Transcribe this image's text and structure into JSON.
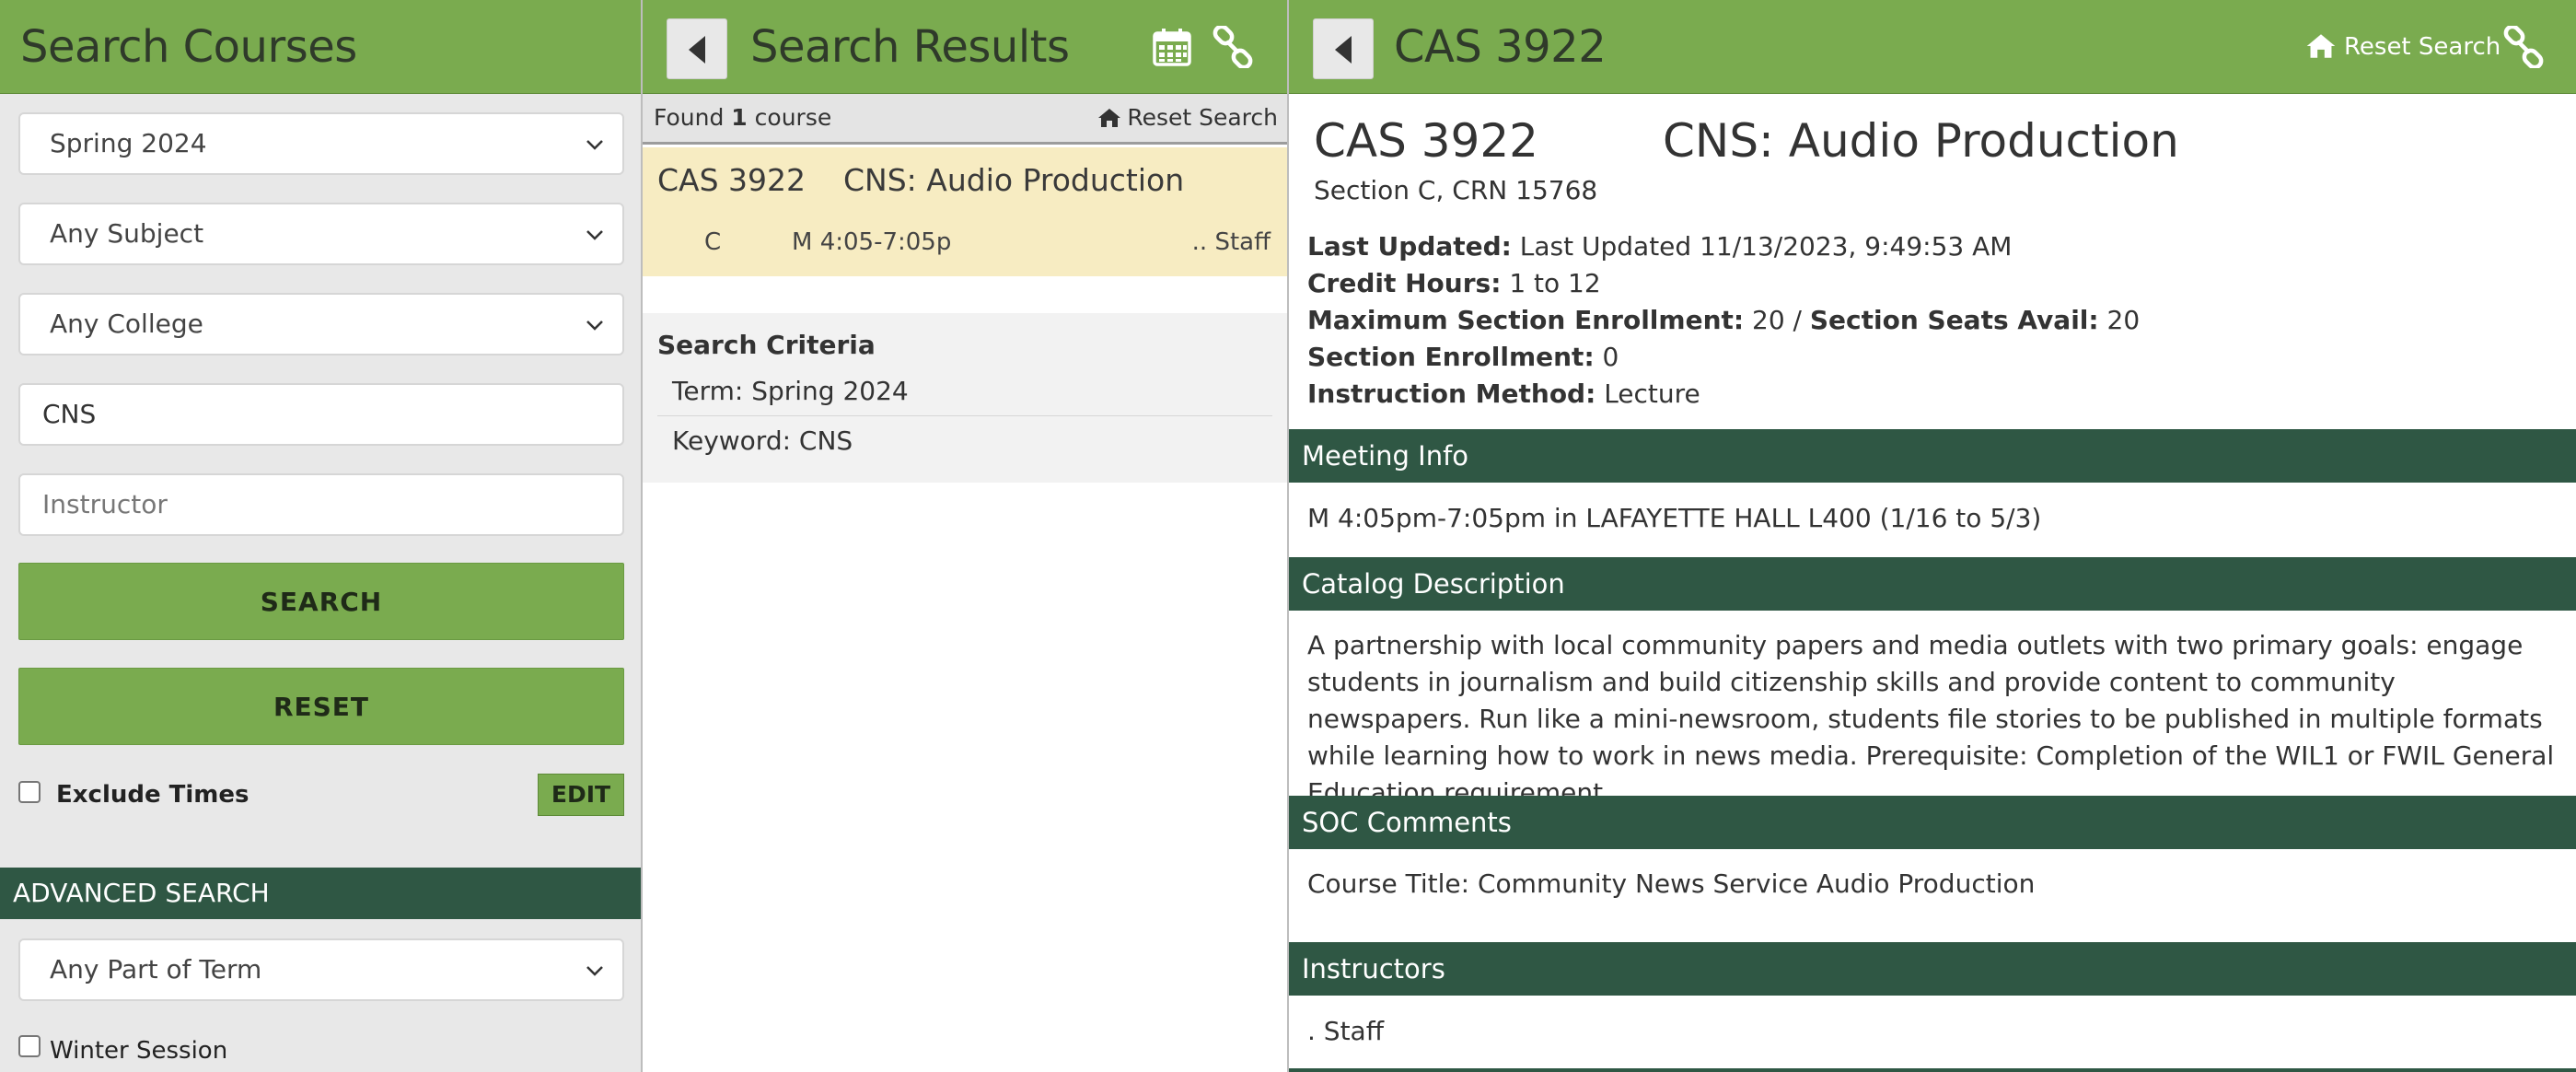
{
  "left": {
    "title": "Search Courses",
    "term_select": "Spring 2024",
    "subject_select": "Any Subject",
    "college_select": "Any College",
    "keyword_value": "CNS",
    "instructor_placeholder": "Instructor",
    "search_label": "SEARCH",
    "reset_label": "RESET",
    "exclude_times_label": "Exclude Times",
    "edit_label": "EDIT",
    "advanced_label": "ADVANCED SEARCH",
    "part_of_term_select": "Any Part of Term",
    "winter_session_label": "Winter Session"
  },
  "mid": {
    "title": "Search Results",
    "found_prefix": "Found ",
    "found_count": "1",
    "found_suffix": " course",
    "reset_search_label": "Reset Search",
    "result": {
      "code": "CAS 3922",
      "title": "CNS: Audio Production",
      "section": "C",
      "time": "M 4:05-7:05p",
      "instructor": ".. Staff"
    },
    "criteria": {
      "heading": "Search Criteria",
      "term": "Term: Spring 2024",
      "keyword": "Keyword: CNS"
    }
  },
  "right": {
    "header_title": "CAS 3922",
    "reset_search_label": "Reset Search",
    "course_code": "CAS 3922",
    "course_title": "CNS: Audio Production",
    "section_crn": "Section C, CRN 15768",
    "last_updated_label": "Last Updated:",
    "last_updated_value": "Last Updated 11/13/2023, 9:49:53 AM",
    "credit_hours_label": "Credit Hours:",
    "credit_hours_value": "1 to 12",
    "max_enroll_label": "Maximum Section Enrollment:",
    "max_enroll_value": "20 /",
    "seats_avail_label": "Section Seats Avail:",
    "seats_avail_value": "20",
    "section_enroll_label": "Section Enrollment:",
    "section_enroll_value": "0",
    "instruction_method_label": "Instruction Method:",
    "instruction_method_value": "Lecture",
    "meeting_info_heading": "Meeting Info",
    "meeting_info": "M 4:05pm-7:05pm in LAFAYETTE HALL L400 (1/16 to 5/3)",
    "catalog_heading": "Catalog Description",
    "catalog_text": "A partnership with local community papers and media outlets with two primary goals: engage students in journalism and build citizenship skills and provide content to community newspapers. Run like a mini-newsroom, students file stories to be published in multiple formats while learning how to work in news media. Prerequisite: Completion of the WIL1 or FWIL General Education requirement.",
    "soc_heading": "SOC Comments",
    "soc_text": "Course Title: Community News Service Audio Production",
    "instructors_heading": "Instructors",
    "instructors_text": ". Staff"
  },
  "colors": {
    "header_green": "#7aab4f",
    "dark_green": "#2f5744",
    "result_highlight": "#f7ecc2"
  },
  "icons": [
    "back-arrow-icon",
    "calendar-icon",
    "link-icon",
    "home-icon",
    "chevron-down-icon"
  ]
}
